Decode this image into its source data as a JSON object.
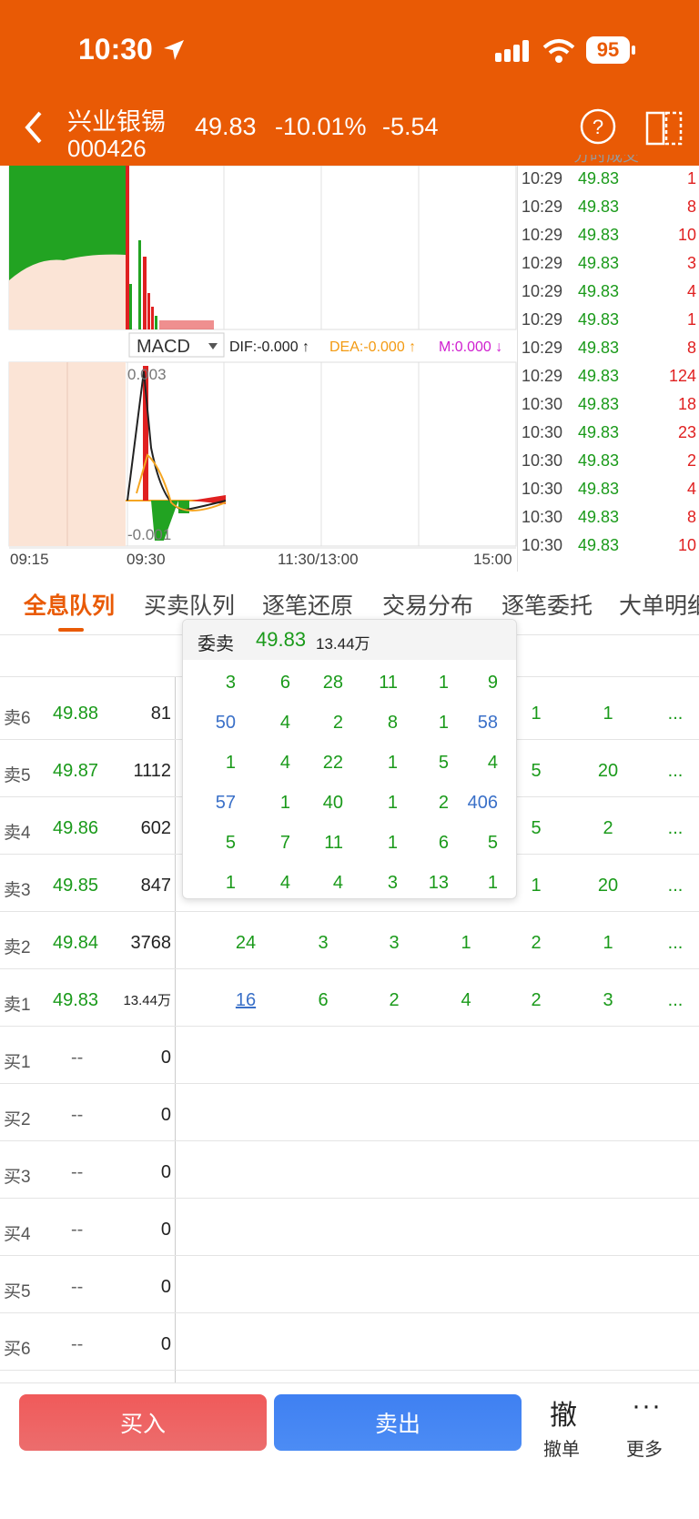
{
  "status_bar": {
    "time": "10:30",
    "battery": "95"
  },
  "header": {
    "name": "兴业银锡",
    "code": "000426",
    "price": "49.83",
    "pct": "-10.01%",
    "change": "-5.54"
  },
  "chart": {
    "panel_title": "分时成交",
    "macd": {
      "label": "MACD",
      "dif": "DIF:-0.000 ↑",
      "dea": "DEA:-0.000 ↑",
      "m": "M:0.000 ↓",
      "top": "0.003",
      "bottom": "-0.001"
    },
    "x_labels": [
      "09:15",
      "09:30",
      "11:30/13:00",
      "15:00"
    ]
  },
  "ticks": [
    {
      "t": "10:29",
      "p": "49.83",
      "v": "1"
    },
    {
      "t": "10:29",
      "p": "49.83",
      "v": "8"
    },
    {
      "t": "10:29",
      "p": "49.83",
      "v": "10"
    },
    {
      "t": "10:29",
      "p": "49.83",
      "v": "3"
    },
    {
      "t": "10:29",
      "p": "49.83",
      "v": "4"
    },
    {
      "t": "10:29",
      "p": "49.83",
      "v": "1"
    },
    {
      "t": "10:29",
      "p": "49.83",
      "v": "8"
    },
    {
      "t": "10:29",
      "p": "49.83",
      "v": "124"
    },
    {
      "t": "10:30",
      "p": "49.83",
      "v": "18"
    },
    {
      "t": "10:30",
      "p": "49.83",
      "v": "23"
    },
    {
      "t": "10:30",
      "p": "49.83",
      "v": "2"
    },
    {
      "t": "10:30",
      "p": "49.83",
      "v": "4"
    },
    {
      "t": "10:30",
      "p": "49.83",
      "v": "8"
    },
    {
      "t": "10:30",
      "p": "49.83",
      "v": "10"
    }
  ],
  "tabs": [
    "全息队列",
    "买卖队列",
    "逐笔还原",
    "交易分布",
    "逐笔委托",
    "大单明细"
  ],
  "book": {
    "asks": [
      {
        "label": "卖6",
        "price": "49.88",
        "vol": "81",
        "queue": [
          "1",
          "1",
          "..."
        ]
      },
      {
        "label": "卖5",
        "price": "49.87",
        "vol": "1112",
        "queue": [
          "5",
          "20",
          "..."
        ]
      },
      {
        "label": "卖4",
        "price": "49.86",
        "vol": "602",
        "queue": [
          "5",
          "2",
          "..."
        ]
      },
      {
        "label": "卖3",
        "price": "49.85",
        "vol": "847",
        "queue": [
          "1",
          "20",
          "..."
        ]
      },
      {
        "label": "卖2",
        "price": "49.84",
        "vol": "3768",
        "queue": [
          "24",
          "3",
          "3",
          "1",
          "2",
          "1",
          "..."
        ]
      },
      {
        "label": "卖1",
        "price": "49.83",
        "vol": "13.44万",
        "queue": [
          "16",
          "6",
          "2",
          "4",
          "2",
          "3",
          "..."
        ]
      }
    ],
    "bids": [
      {
        "label": "买1",
        "price": "--",
        "vol": "0"
      },
      {
        "label": "买2",
        "price": "--",
        "vol": "0"
      },
      {
        "label": "买3",
        "price": "--",
        "vol": "0"
      },
      {
        "label": "买4",
        "price": "--",
        "vol": "0"
      },
      {
        "label": "买5",
        "price": "--",
        "vol": "0"
      },
      {
        "label": "买6",
        "price": "--",
        "vol": "0"
      }
    ]
  },
  "popup": {
    "title": "委卖",
    "price": "49.83",
    "vol": "13.44万",
    "rows": [
      [
        "3",
        "6",
        "28",
        "11",
        "1",
        "9"
      ],
      [
        "50",
        "4",
        "2",
        "8",
        "1",
        "58"
      ],
      [
        "1",
        "4",
        "22",
        "1",
        "5",
        "4"
      ],
      [
        "57",
        "1",
        "40",
        "1",
        "2",
        "406"
      ],
      [
        "5",
        "7",
        "11",
        "1",
        "6",
        "5"
      ],
      [
        "1",
        "4",
        "4",
        "3",
        "13",
        "1"
      ]
    ]
  },
  "bottom": {
    "buy": "买入",
    "sell": "卖出",
    "cancel_icon": "撤",
    "cancel": "撤单",
    "more": "更多"
  }
}
